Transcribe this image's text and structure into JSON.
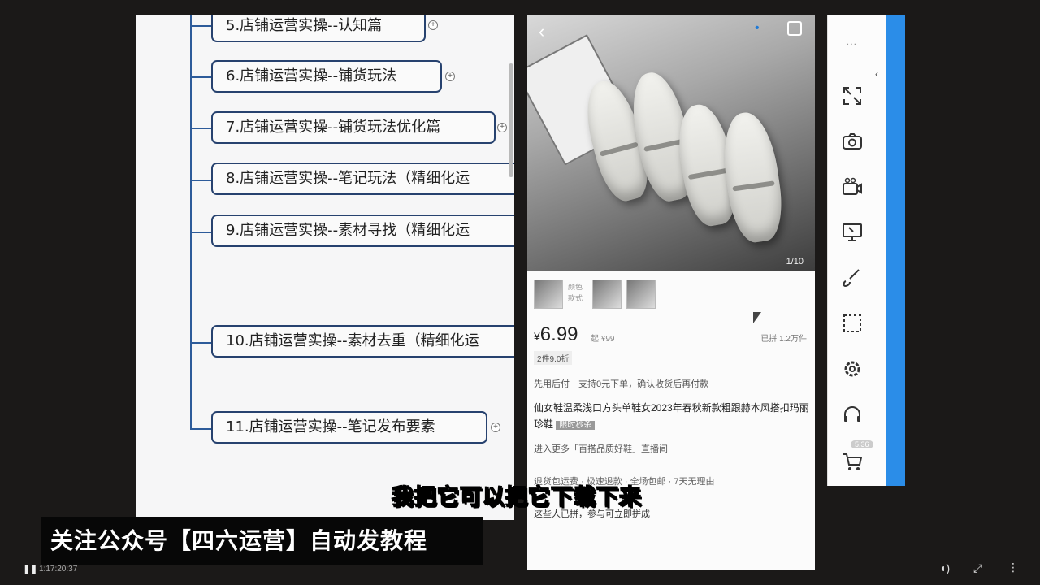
{
  "mindmap": {
    "nodes": [
      {
        "label": "5.店铺运营实操--认知篇"
      },
      {
        "label": "6.店铺运营实操--铺货玩法"
      },
      {
        "label": "7.店铺运营实操--铺货玩法优化篇"
      },
      {
        "label": "8.店铺运营实操--笔记玩法（精细化运"
      },
      {
        "label": "9.店铺运营实操--素材寻找（精细化运"
      },
      {
        "label": "10.店铺运营实操--素材去重（精细化运"
      },
      {
        "label": "11.店铺运营实操--笔记发布要素"
      }
    ]
  },
  "product": {
    "photo_counter": "1/10",
    "color_label": "颜色 款式",
    "price_symbol": "¥",
    "price": "6.99",
    "price_orig": "起 ¥99",
    "sold": "已拼 1.2万件",
    "discount": "2件9.0折",
    "guarantee": "先用后付｜支持0元下单，确认收货后再付款",
    "title": "仙女鞋温柔浅口方头单鞋女2023年春秋新款粗跟赫本风搭扣玛丽珍鞋",
    "title_tag": "限时秒杀",
    "live": "进入更多「百搭品质好鞋」直播间",
    "service": "退货包运费 · 极速退款 · 全场包邮 · 7天无理由",
    "group": "这些人已拼，参与可立即拼成"
  },
  "toolbar": {
    "items": [
      "expand-icon",
      "camera-icon",
      "video-record-icon",
      "screen-share-icon",
      "brush-icon",
      "select-region-icon",
      "settings-icon",
      "headset-icon",
      "cart-icon"
    ],
    "badge": "5.36"
  },
  "overlay": {
    "banner": "关注公众号【四六运营】自动发教程",
    "subtitle": "我把它可以把它下载下来"
  },
  "video": {
    "time": "1:17:20:37"
  }
}
